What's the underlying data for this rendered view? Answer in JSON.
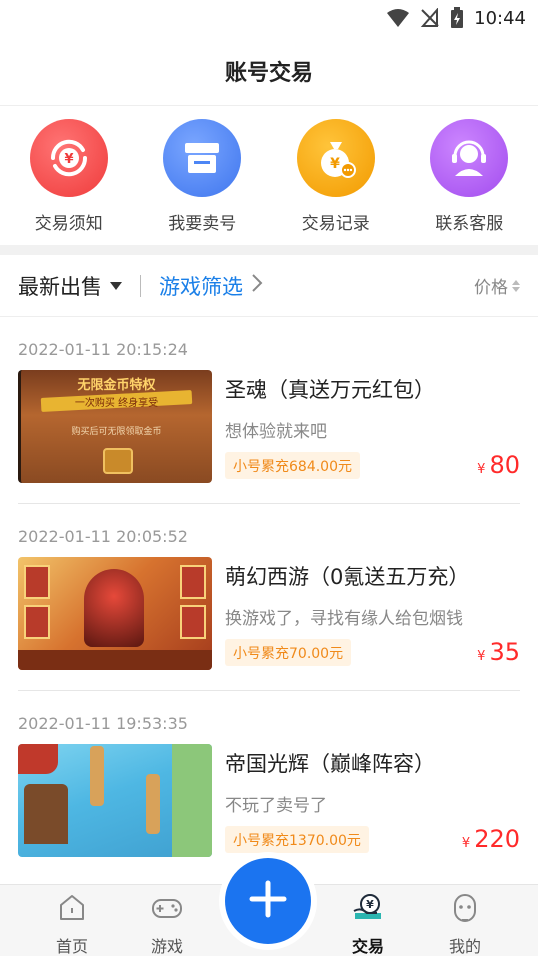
{
  "status_bar": {
    "time": "10:44"
  },
  "header": {
    "title": "账号交易"
  },
  "quick_actions": [
    {
      "label": "交易须知",
      "icon": "refresh-yuan-icon",
      "color": "#f24545"
    },
    {
      "label": "我要卖号",
      "icon": "storefront-icon",
      "color": "#4d86f5"
    },
    {
      "label": "交易记录",
      "icon": "money-bag-icon",
      "color": "#f6a400"
    },
    {
      "label": "联系客服",
      "icon": "headset-support-icon",
      "color": "#b35ef2"
    }
  ],
  "filter_bar": {
    "latest_label": "最新出售",
    "game_filter_label": "游戏筛选",
    "price_label": "价格"
  },
  "listings": [
    {
      "timestamp": "2022-01-11 20:15:24",
      "title": "圣魂（真送万元红包）",
      "desc": "想体验就来吧",
      "badge": "小号累充684.00元",
      "price_symbol": "¥",
      "price": "80",
      "thumb_text_1": "无限金币特权",
      "thumb_text_2": "一次购买 终身享受",
      "thumb_text_3": "购买后可无限领取金币"
    },
    {
      "timestamp": "2022-01-11 20:05:52",
      "title": "萌幻西游（0氪送五万充）",
      "desc": "换游戏了，寻找有缘人给包烟钱",
      "badge": "小号累充70.00元",
      "price_symbol": "¥",
      "price": "35"
    },
    {
      "timestamp": "2022-01-11 19:53:35",
      "title": "帝国光辉（巅峰阵容）",
      "desc": "不玩了卖号了",
      "badge": "小号累充1370.00元",
      "price_symbol": "¥",
      "price": "220"
    }
  ],
  "bottom_nav": [
    {
      "label": "首页",
      "icon": "home-icon"
    },
    {
      "label": "游戏",
      "icon": "gamepad-icon"
    },
    {
      "label": "交易",
      "icon": "trade-yuan-icon",
      "active": true
    },
    {
      "label": "我的",
      "icon": "profile-face-icon"
    }
  ],
  "colors": {
    "accent": "#1a7fe8",
    "price": "#ff2a2a",
    "badge_text": "#f08a1a",
    "fab": "#1b74f0"
  }
}
